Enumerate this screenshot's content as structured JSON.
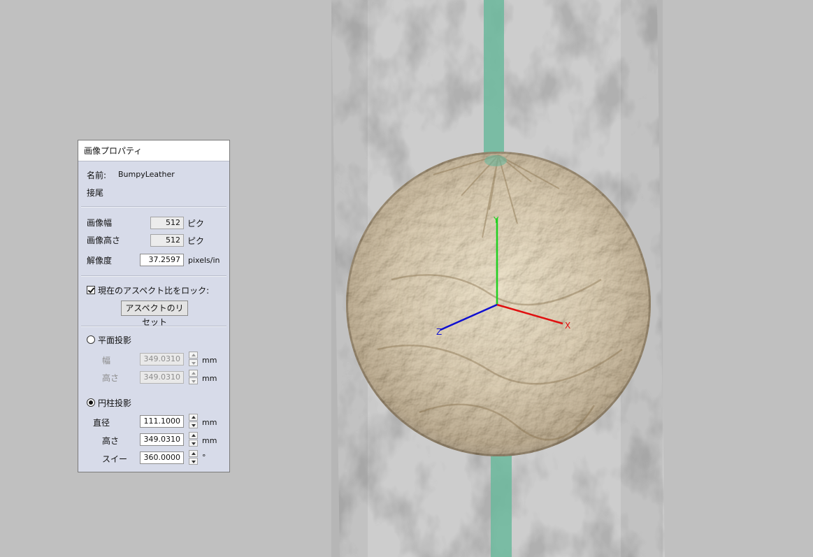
{
  "panel": {
    "title": "画像プロパティ",
    "name_label": "名前:",
    "name_value": "BumpyLeather",
    "suffix_label": "接尾",
    "image_width_label": "画像幅",
    "image_width_value": "512",
    "image_width_unit": "ピク",
    "image_height_label": "画像高さ",
    "image_height_value": "512",
    "image_height_unit": "ピク",
    "resolution_label": "解像度",
    "resolution_value": "37.2597",
    "resolution_unit": "pixels/in",
    "lock_aspect_label": "現在のアスペクト比をロック:",
    "lock_aspect_checked": true,
    "reset_aspect_button": "アスペクトのリセット",
    "planar": {
      "label": "平面投影",
      "selected": false,
      "width_label": "幅",
      "width_value": "349.0310",
      "width_unit": "mm",
      "height_label": "高さ",
      "height_value": "349.0310",
      "height_unit": "mm"
    },
    "cylindrical": {
      "label": "円柱投影",
      "selected": true,
      "diameter_label": "直径",
      "diameter_value": "111.1000",
      "diameter_unit": "mm",
      "height_label": "高さ",
      "height_value": "349.0310",
      "height_unit": "mm",
      "sweep_label": "スイー",
      "sweep_value": "360.0000",
      "sweep_unit": "°"
    }
  },
  "viewport": {
    "axis_x": "X",
    "axis_y": "Y",
    "axis_z": "Z",
    "colors": {
      "background": "#c0c0c0",
      "sphere": "#c9b48d",
      "guide_strip": "#6bb89c",
      "axis_x": "#e01010",
      "axis_y": "#20d020",
      "axis_z": "#1010d0"
    }
  }
}
